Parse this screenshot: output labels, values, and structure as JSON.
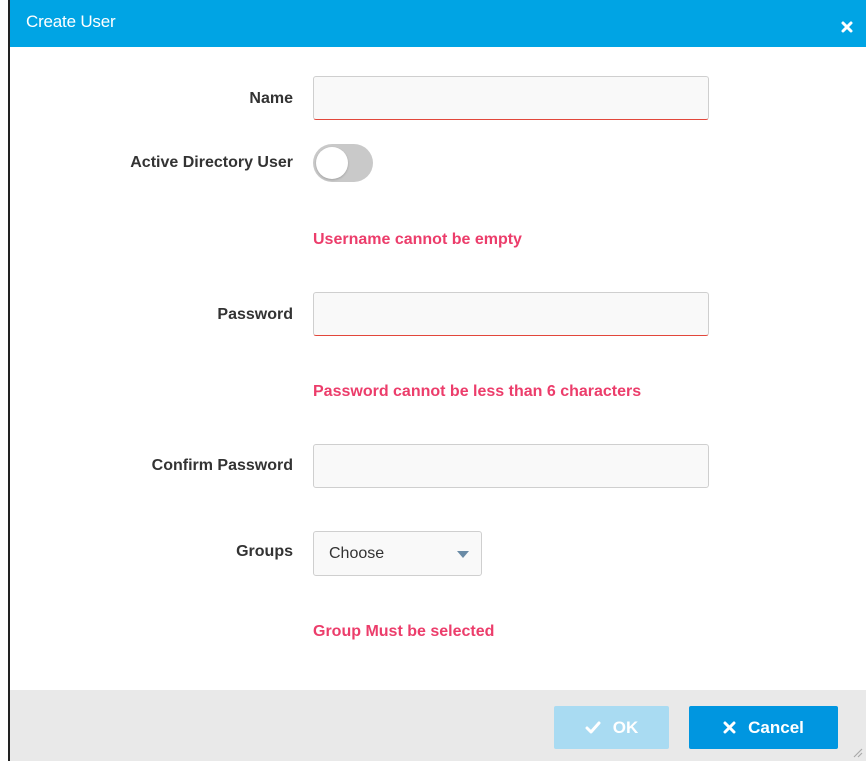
{
  "dialog": {
    "title": "Create User",
    "close_icon": "close-icon"
  },
  "form": {
    "name": {
      "label": "Name",
      "value": ""
    },
    "active_directory": {
      "label": "Active Directory User",
      "enabled": false
    },
    "username_error": "Username cannot be empty",
    "password": {
      "label": "Password",
      "value": ""
    },
    "password_error": "Password cannot be less than 6 characters",
    "confirm_password": {
      "label": "Confirm Password",
      "value": ""
    },
    "groups": {
      "label": "Groups",
      "selected": "Choose"
    },
    "groups_error": "Group Must be selected"
  },
  "footer": {
    "ok_label": "OK",
    "ok_icon": "check-icon",
    "cancel_label": "Cancel",
    "cancel_icon": "close-icon"
  },
  "colors": {
    "titlebar": "#00a4e4",
    "error": "#ec3d6b",
    "primary_button": "#0096e0",
    "disabled_button": "#a9dbf2"
  }
}
